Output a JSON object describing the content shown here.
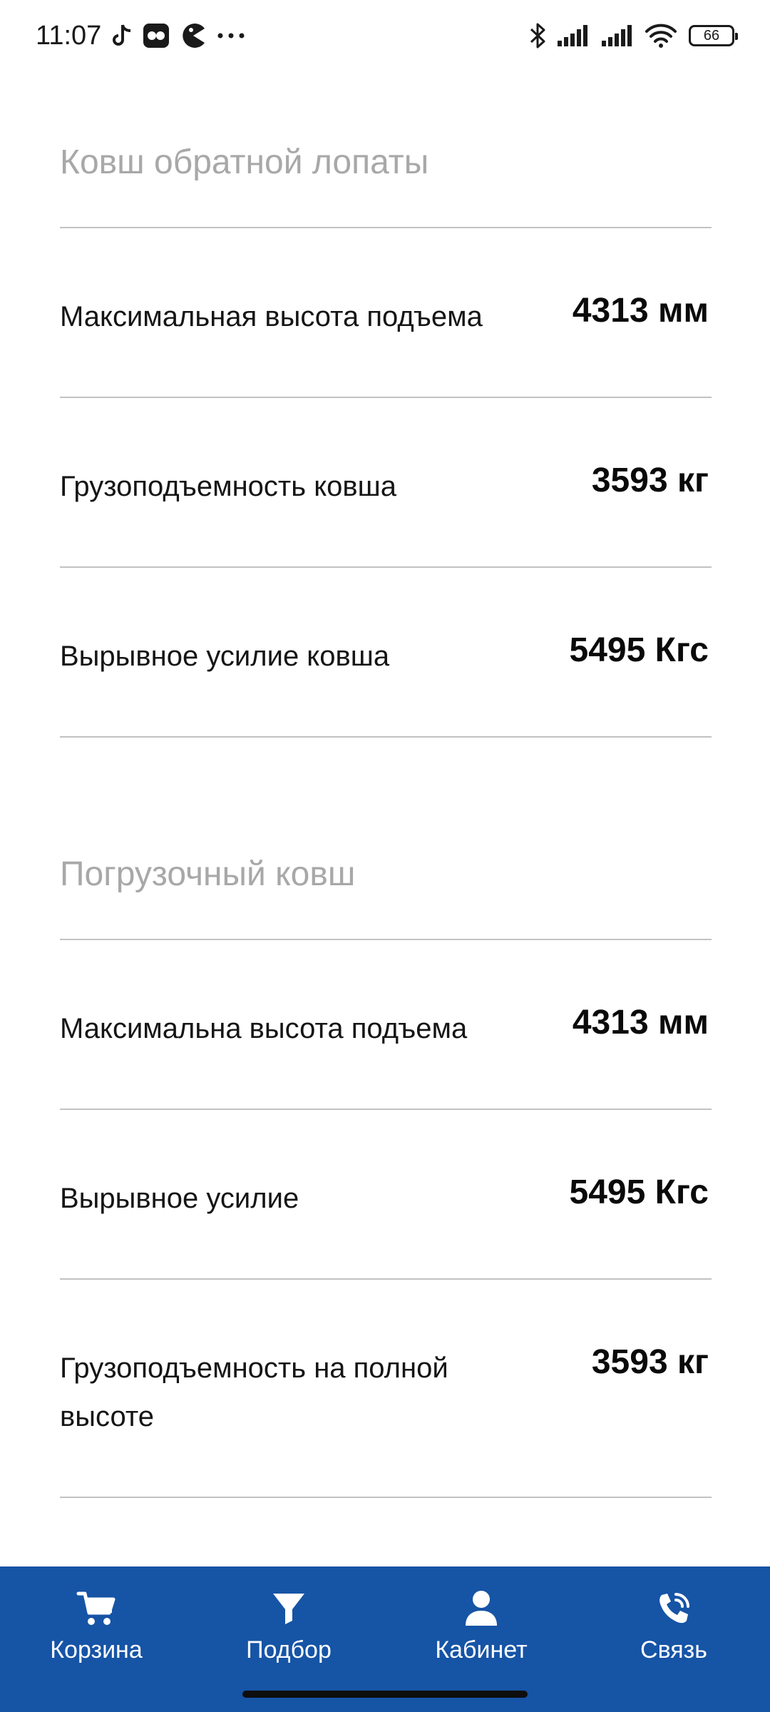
{
  "status_bar": {
    "time": "11:07",
    "battery": "66"
  },
  "sections": [
    {
      "title": "Ковш обратной лопаты",
      "rows": [
        {
          "label": "Максимальная высота подъема",
          "value": "4313 мм"
        },
        {
          "label": "Грузоподъемность ковша",
          "value": "3593 кг"
        },
        {
          "label": "Вырывное усилие ковша",
          "value": "5495 Кгс"
        }
      ]
    },
    {
      "title": "Погрузочный ковш",
      "rows": [
        {
          "label": "Максимальна высота подъема",
          "value": "4313 мм"
        },
        {
          "label": "Вырывное усилие",
          "value": "5495 Кгс"
        },
        {
          "label": "Грузоподъемность на полной высоте",
          "value": "3593 кг"
        }
      ]
    }
  ],
  "bottom_nav": {
    "items": [
      {
        "label": "Корзина",
        "icon": "cart-icon"
      },
      {
        "label": "Подбор",
        "icon": "funnel-icon"
      },
      {
        "label": "Кабинет",
        "icon": "user-icon"
      },
      {
        "label": "Связь",
        "icon": "phone-call-icon"
      }
    ]
  },
  "colors": {
    "nav_background": "#1654a6",
    "section_title": "#a8a8a8",
    "divider": "#c2c2c2"
  }
}
